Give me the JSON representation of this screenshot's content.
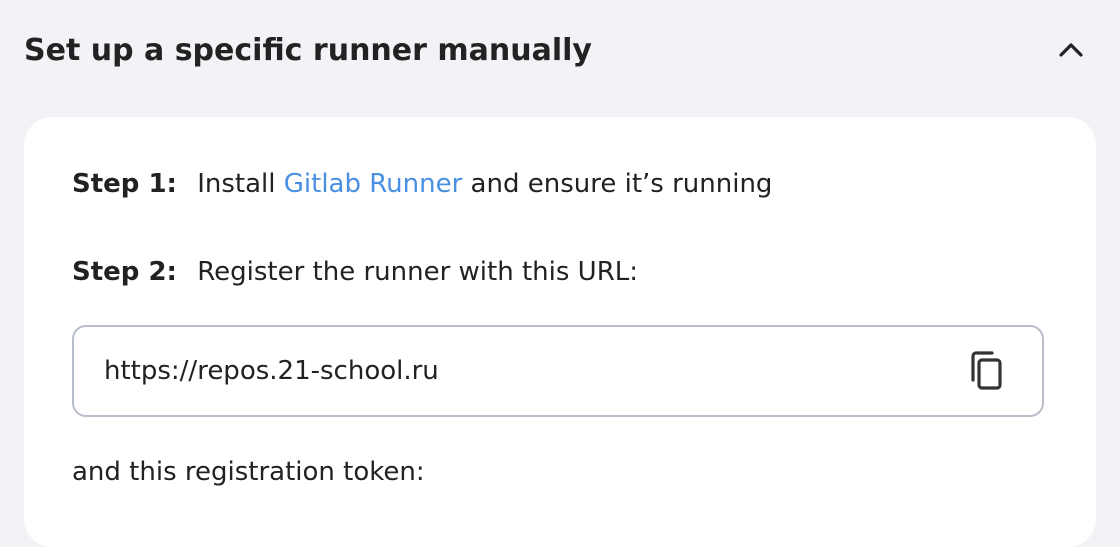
{
  "section": {
    "title": "Set up a specific runner manually",
    "expanded": true,
    "icon": "chevron-up-icon"
  },
  "steps": {
    "step1": {
      "label": "Step 1:",
      "text_before": "Install",
      "link": "Gitlab Runner",
      "text_after": "and ensure it’s running"
    },
    "step2": {
      "label": "Step 2:",
      "text": "Register the runner with this URL:"
    }
  },
  "url_field": {
    "value": "https://repos.21-school.ru",
    "copy_icon": "copy-icon"
  },
  "token_label": "and this registration token:",
  "colors": {
    "background": "#f3f3f7",
    "card": "#ffffff",
    "link": "#4a90e2",
    "border": "#b8bec9",
    "text": "#222222"
  }
}
